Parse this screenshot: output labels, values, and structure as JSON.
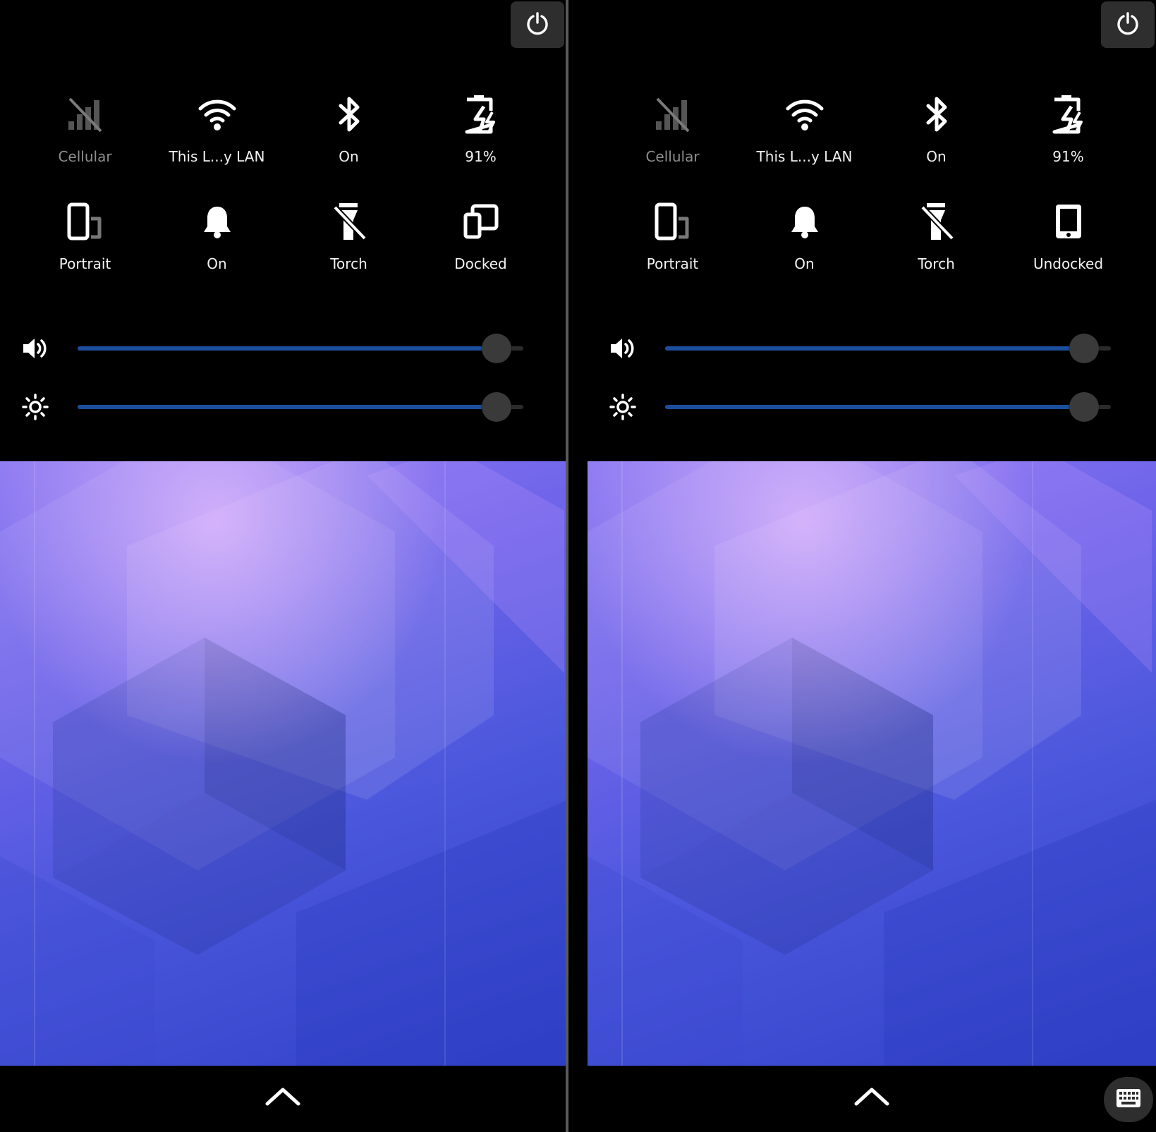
{
  "screens": [
    {
      "id": "left",
      "tiles": [
        {
          "name": "cellular",
          "label": "Cellular",
          "icon": "cellular-off-icon",
          "dim": true
        },
        {
          "name": "wifi",
          "label": "This L...y LAN",
          "icon": "wifi-icon",
          "dim": false
        },
        {
          "name": "bluetooth",
          "label": "On",
          "icon": "bluetooth-icon",
          "dim": false
        },
        {
          "name": "battery",
          "label": "91%",
          "icon": "battery-charging-icon",
          "dim": false
        },
        {
          "name": "rotation",
          "label": "Portrait",
          "icon": "rotation-portrait-icon",
          "dim": false
        },
        {
          "name": "notifications",
          "label": "On",
          "icon": "bell-icon",
          "dim": false
        },
        {
          "name": "torch",
          "label": "Torch",
          "icon": "torch-off-icon",
          "dim": false
        },
        {
          "name": "docked",
          "label": "Docked",
          "icon": "docked-icon",
          "dim": false
        }
      ],
      "volume_level": 0.94,
      "brightness_level": 0.94,
      "show_keyboard_button": false
    },
    {
      "id": "right",
      "tiles": [
        {
          "name": "cellular",
          "label": "Cellular",
          "icon": "cellular-off-icon",
          "dim": true
        },
        {
          "name": "wifi",
          "label": "This L...y LAN",
          "icon": "wifi-icon",
          "dim": false
        },
        {
          "name": "bluetooth",
          "label": "On",
          "icon": "bluetooth-icon",
          "dim": false
        },
        {
          "name": "battery",
          "label": "91%",
          "icon": "battery-charging-icon",
          "dim": false
        },
        {
          "name": "rotation",
          "label": "Portrait",
          "icon": "rotation-portrait-icon",
          "dim": false
        },
        {
          "name": "notifications",
          "label": "On",
          "icon": "bell-icon",
          "dim": false
        },
        {
          "name": "torch",
          "label": "Torch",
          "icon": "torch-off-icon",
          "dim": false
        },
        {
          "name": "docked",
          "label": "Undocked",
          "icon": "undocked-icon",
          "dim": false
        }
      ],
      "volume_level": 0.94,
      "brightness_level": 0.94,
      "show_keyboard_button": true
    }
  ],
  "icons": {
    "power": "power-icon",
    "volume": "volume-high-icon",
    "brightness": "brightness-icon",
    "home": "chevron-up-icon",
    "keyboard": "keyboard-icon"
  },
  "colors": {
    "panel_bg": "#000000",
    "slider_fill": "#1c4e9e",
    "button_bg": "#2e2e2e",
    "label": "#f2f2f2",
    "label_dim": "#8e8e8e"
  }
}
